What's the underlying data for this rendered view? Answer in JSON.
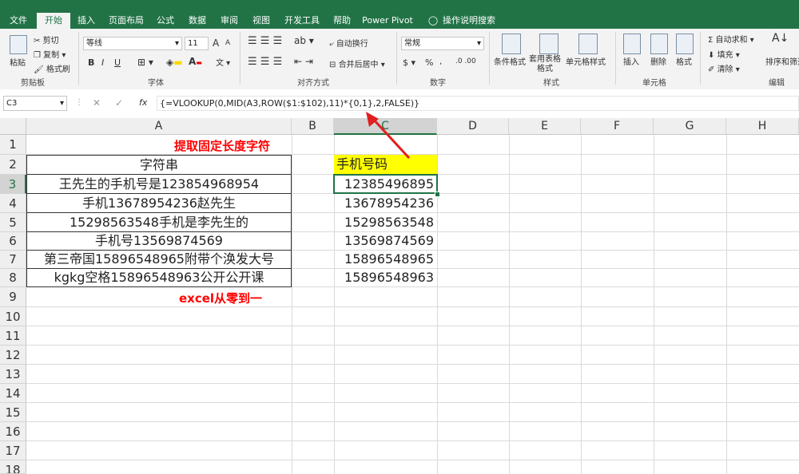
{
  "ribbon_tabs": [
    "文件",
    "开始",
    "插入",
    "页面布局",
    "公式",
    "数据",
    "审阅",
    "视图",
    "开发工具",
    "帮助",
    "Power Pivot",
    "操作说明搜索"
  ],
  "active_tab": "开始",
  "clipboard": {
    "paste": "粘贴",
    "cut": "剪切",
    "copy": "复制",
    "format_painter": "格式刷",
    "group": "剪贴板"
  },
  "font": {
    "name": "等线",
    "size": "11",
    "group": "字体",
    "bold": "B",
    "italic": "I",
    "underline": "U",
    "grow": "A",
    "shrink": "A"
  },
  "alignment": {
    "wrap": "自动换行",
    "merge": "合并后居中",
    "group": "对齐方式"
  },
  "number": {
    "format": "常规",
    "percent": "%",
    "group": "数字"
  },
  "styles": {
    "conditional": "条件格式",
    "table": "套用表格格式",
    "cell_styles": "单元格样式",
    "group": "样式"
  },
  "cells": {
    "insert": "插入",
    "delete": "删除",
    "format": "格式",
    "group": "单元格"
  },
  "editing": {
    "autosum": "自动求和",
    "fill": "填充",
    "clear": "清除",
    "sort": "排序和筛选",
    "group": "编辑"
  },
  "formula_bar": {
    "name_box": "C3",
    "fx": "fx",
    "formula": "{=VLOOKUP(0,MID(A3,ROW($1:$102),11)*{0,1},2,FALSE)}"
  },
  "columns": [
    "A",
    "B",
    "C",
    "D",
    "E",
    "F",
    "G",
    "H"
  ],
  "rows": [
    "1",
    "2",
    "3",
    "4",
    "5",
    "6",
    "7",
    "8",
    "9",
    "10",
    "11",
    "12",
    "13",
    "14",
    "15",
    "16",
    "17",
    "18"
  ],
  "sheet": {
    "a1_title": "提取固定长度字符",
    "a2_header": "字符串",
    "c2_header": "手机号码",
    "a_values": [
      "王先生的手机号是123854968954",
      "手机13678954236赵先生",
      "15298563548手机是李先生的",
      "手机号13569874569",
      "第三帝国15896548965附带个涣发大号",
      "kgkg空格15896548963公开公开课"
    ],
    "c_values": [
      "12385496895",
      "13678954236",
      "15298563548",
      "13569874569",
      "15896548965",
      "15896548963"
    ],
    "a9_note": "excel从零到一"
  },
  "colors": {
    "excel_green": "#217346",
    "title_red": "#ff0000",
    "header_yellow": "#ffff00",
    "arrow_red": "#e02020"
  }
}
